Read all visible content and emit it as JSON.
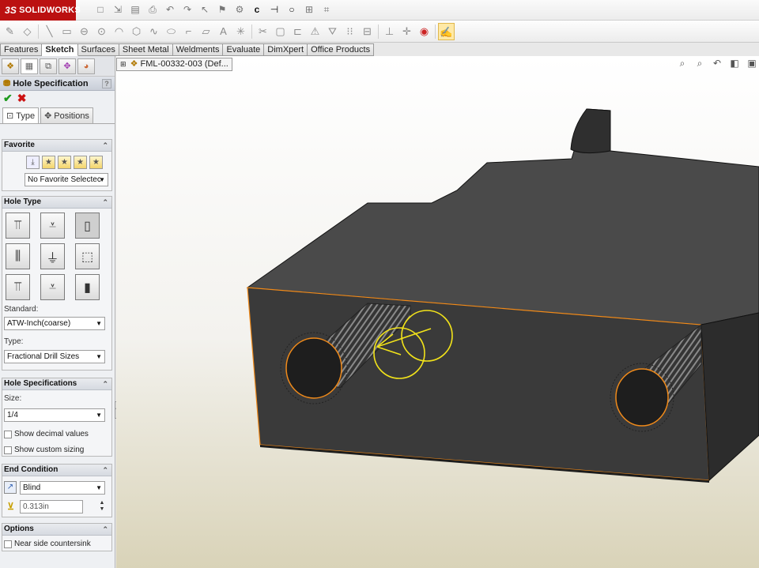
{
  "app": {
    "logo_ds": "3S",
    "logo_name": "SOLIDWORKS"
  },
  "quick_access_icons": [
    "new-icon",
    "open-icon",
    "save-icon",
    "print-icon",
    "undo-icon",
    "redo-icon",
    "select-icon",
    "rebuild-icon",
    "options-icon"
  ],
  "command_tabs": [
    {
      "label": "Features",
      "active": false
    },
    {
      "label": "Sketch",
      "active": true
    },
    {
      "label": "Surfaces",
      "active": false
    },
    {
      "label": "Sheet Metal",
      "active": false
    },
    {
      "label": "Weldments",
      "active": false
    },
    {
      "label": "Evaluate",
      "active": false
    },
    {
      "label": "DimXpert",
      "active": false
    },
    {
      "label": "Office Products",
      "active": false
    }
  ],
  "feature_tree": {
    "flyout_label": "FML-00332-003  (Def..."
  },
  "property_manager": {
    "title": "Hole Specification",
    "help": "?",
    "ok": "✔",
    "cancel": "✖",
    "subtabs": {
      "type": "Type",
      "positions": "Positions"
    },
    "favorite": {
      "title": "Favorite",
      "selected": "No Favorite Selectec"
    },
    "hole_type": {
      "title": "Hole Type",
      "standard_label": "Standard:",
      "standard_value": "ATW-Inch(coarse)",
      "type_label": "Type:",
      "type_value": "Fractional Drill Sizes"
    },
    "hole_specifications": {
      "title": "Hole Specifications",
      "size_label": "Size:",
      "size_value": "1/4",
      "show_decimal": "Show decimal values",
      "show_custom": "Show custom sizing"
    },
    "end_condition": {
      "title": "End Condition",
      "value": "Blind",
      "depth": "0.313in"
    },
    "options": {
      "title": "Options",
      "near_side": "Near side countersink"
    }
  },
  "colors": {
    "part": "#3f3f3f",
    "part_top": "#4a4a4a",
    "edge_highlight": "#f08a1a",
    "preview": "#f2e31a"
  }
}
